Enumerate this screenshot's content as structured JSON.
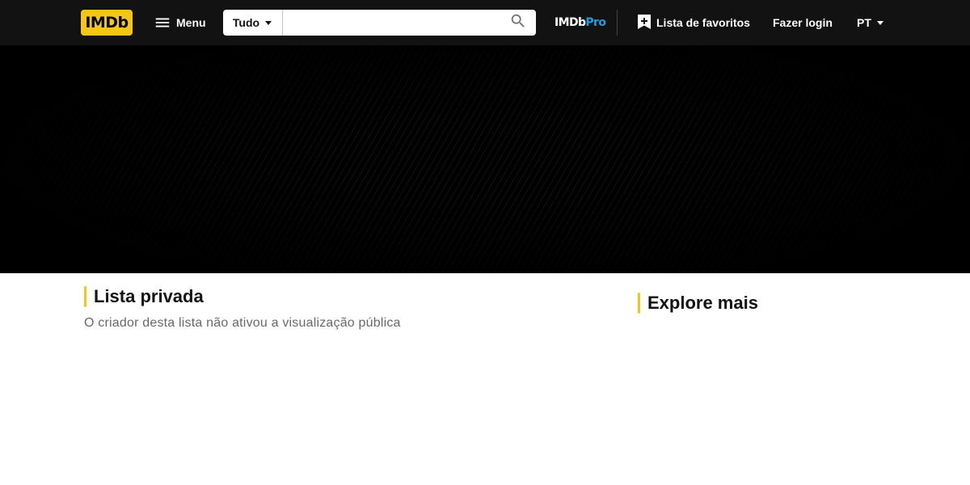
{
  "header": {
    "logo_text": "IMDb",
    "menu_label": "Menu",
    "search": {
      "category": "Tudo",
      "value": "",
      "placeholder": ""
    },
    "pro": {
      "imdb_part": "IMDb",
      "pro_part": "Pro"
    },
    "watchlist_label": "Lista de favoritos",
    "signin_label": "Fazer login",
    "language": "PT"
  },
  "main": {
    "title": "Lista privada",
    "message": "O criador desta lista não ativou a visualização pública"
  },
  "sidebar": {
    "title": "Explore mais"
  },
  "colors": {
    "brand_yellow": "#f5c518",
    "pro_blue": "#1ea0db",
    "nav_background": "#121212"
  },
  "icons": [
    "hamburger-menu-icon",
    "caret-down-icon",
    "search-icon",
    "bookmark-add-icon",
    "caret-down-icon"
  ]
}
